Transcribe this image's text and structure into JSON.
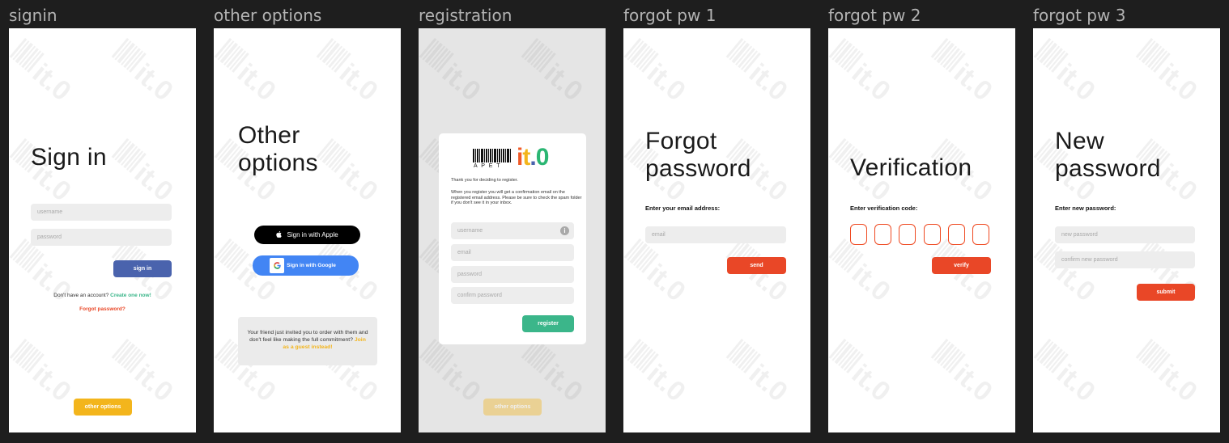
{
  "frames": {
    "signin": {
      "label": "signin",
      "title": "Sign in",
      "username_placeholder": "username",
      "password_placeholder": "password",
      "signin_button": "sign in",
      "no_account_text": "Don't have an account?",
      "create_link": "Create one now!",
      "forgot_link": "Forgot password?",
      "other_options_button": "other options"
    },
    "other_options": {
      "label": "other options",
      "title_line1": "Other",
      "title_line2": "options",
      "apple_button": "Sign in with Apple",
      "google_button": "Sign in with Google",
      "guest_text": "Your friend just invited you to order with them and don't feel like making the full commitment?",
      "guest_link": "Join as a guest instead!"
    },
    "registration": {
      "label": "registration",
      "logo_text": "it.0",
      "logo_sub": "A P E T",
      "thanks_text": "Thank you for deciding to register.",
      "info_text": "When you register you will get a confirmation email on the registered email address. Please be sure to check the spam folder if you don't see it in your inbox.",
      "username_placeholder": "username",
      "email_placeholder": "email",
      "password_placeholder": "password",
      "confirm_placeholder": "confirm password",
      "register_button": "register",
      "other_options_button": "other options"
    },
    "forgot1": {
      "label": "forgot pw 1",
      "title_line1": "Forgot",
      "title_line2": "password",
      "email_label": "Enter your email address:",
      "email_placeholder": "email",
      "send_button": "send"
    },
    "forgot2": {
      "label": "forgot pw 2",
      "title": "Verification",
      "code_label": "Enter verification code:",
      "verify_button": "verify"
    },
    "forgot3": {
      "label": "forgot pw 3",
      "title_line1": "New",
      "title_line2": "password",
      "new_pw_label": "Enter new password:",
      "new_pw_placeholder": "new password",
      "confirm_placeholder": "confirm new password",
      "submit_button": "submit"
    }
  },
  "colors": {
    "canvas": "#1e1e1e",
    "blue": "#4a63ad",
    "green": "#3bb68a",
    "red": "#e94727",
    "yellow": "#f3b51c",
    "google_blue": "#4285f4",
    "logo_orange": "#f05a28",
    "logo_green": "#2bb673"
  },
  "icons": [
    "apple-icon",
    "google-icon",
    "info-icon",
    "barcode-icon"
  ]
}
